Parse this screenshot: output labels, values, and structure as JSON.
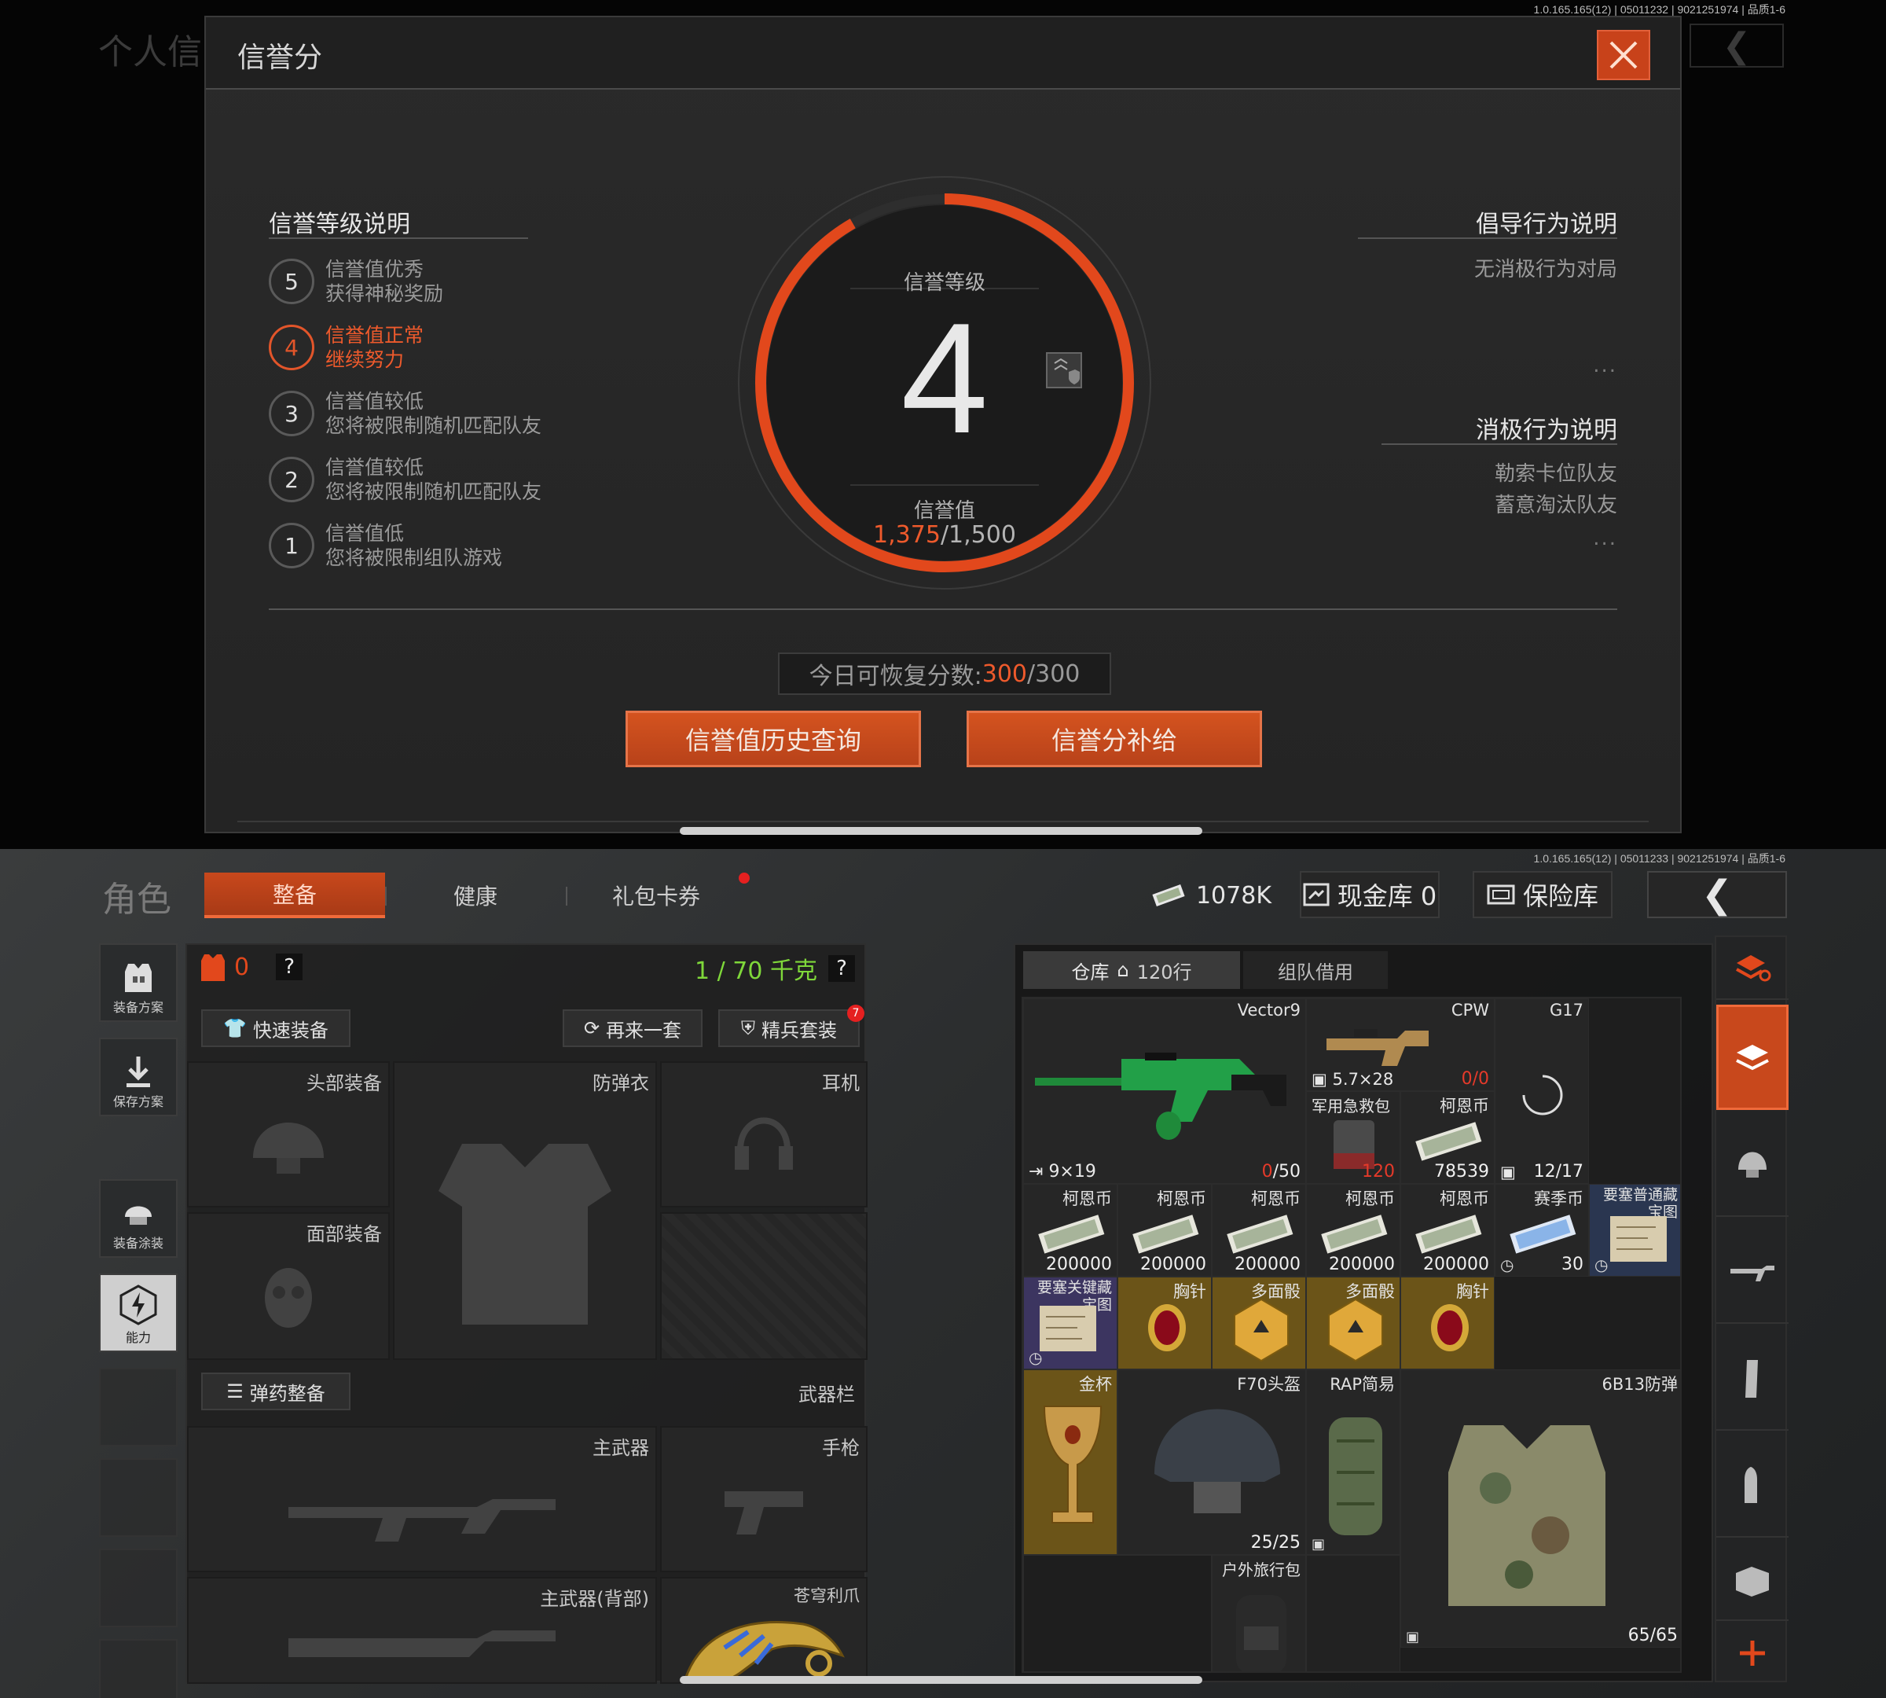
{
  "top": {
    "version": "1.0.165.165(12) | 05011232 | 9021251974 | 品质1-6",
    "bg_title": "个人信",
    "dialog": {
      "title": "信誉分",
      "level_section_title": "信誉等级说明",
      "levels": [
        {
          "num": "5",
          "line1": "信誉值优秀",
          "line2": "获得神秘奖励",
          "active": false
        },
        {
          "num": "4",
          "line1": "信誉值正常",
          "line2": "继续努力",
          "active": true
        },
        {
          "num": "3",
          "line1": "信誉值较低",
          "line2": "您将被限制随机匹配队友",
          "active": false
        },
        {
          "num": "2",
          "line1": "信誉值较低",
          "line2": "您将被限制随机匹配队友",
          "active": false
        },
        {
          "num": "1",
          "line1": "信誉值低",
          "line2": "您将被限制组队游戏",
          "active": false
        }
      ],
      "gauge": {
        "level_label": "信誉等级",
        "level_value": "4",
        "score_label": "信誉值",
        "score_current": "1,375",
        "score_max": "/1,500",
        "fraction": 0.9167
      },
      "guide_title": "倡导行为说明",
      "guide_items": [
        "无消极行为对局"
      ],
      "negative_title": "消极行为说明",
      "negative_items": [
        "勒索卡位队友",
        "蓄意淘汰队友"
      ],
      "dots": "...",
      "recover_label": "今日可恢复分数:",
      "recover_current": "300",
      "recover_max": "/300",
      "btn_history": "信誉值历史查询",
      "btn_replenish": "信誉分补给"
    }
  },
  "bottom": {
    "version": "1.0.165.165(12) | 05011233 | 9021251974 | 品质1-6",
    "title": "角色",
    "tabs": [
      "整备",
      "健康",
      "礼包卡券"
    ],
    "money": "1078K",
    "cash_vault": "现金库 0",
    "safe_vault": "保险库",
    "side_buttons": [
      "装备方案",
      "保存方案",
      "装备涂装",
      "能力"
    ],
    "loadout": {
      "armor_count": "0",
      "weight": "1 / 70 千克",
      "help": "?",
      "quick_equip": "快速装备",
      "again": "再来一套",
      "elite": "精兵套装",
      "elite_badge": "7",
      "slots": {
        "head": "头部装备",
        "vest": "防弹衣",
        "ear": "耳机",
        "face": "面部装备",
        "ammo": "弹药整备",
        "weapon_bar": "武器栏",
        "primary": "主武器",
        "pistol": "手枪",
        "primary_back": "主武器(背部)",
        "melee": "苍穹利爪"
      }
    },
    "storage": {
      "tab_vault": "仓库",
      "vault_rows": "120行",
      "tab_team": "组队借用",
      "items": [
        {
          "name": "Vector9",
          "ammo": "9×19",
          "count": "0",
          "max": "/50"
        },
        {
          "name": "CPW",
          "ammo": "5.7×28",
          "count": "0/0"
        },
        {
          "name": "G17",
          "count": "12/17"
        },
        {
          "name": "军用急救包",
          "count": "120"
        },
        {
          "name": "柯恩币",
          "count": "78539"
        },
        {
          "name": "柯恩币",
          "count": "200000"
        },
        {
          "name": "柯恩币",
          "count": "200000"
        },
        {
          "name": "柯恩币",
          "count": "200000"
        },
        {
          "name": "柯恩币",
          "count": "200000"
        },
        {
          "name": "柯恩币",
          "count": "200000"
        },
        {
          "name": "赛季币",
          "count": "30"
        },
        {
          "name": "要塞普通藏宝图"
        },
        {
          "name": "要塞关键藏宝图"
        },
        {
          "name": "胸针"
        },
        {
          "name": "多面骰"
        },
        {
          "name": "多面骰"
        },
        {
          "name": "胸针"
        },
        {
          "name": "金杯"
        },
        {
          "name": "F70头盔",
          "count": "25/25"
        },
        {
          "name": "RAP简易"
        },
        {
          "name": "6B13防弹",
          "count": "65/65"
        },
        {
          "name": "户外旅行包"
        }
      ]
    },
    "colors": {
      "accent": "#c8481c",
      "highlight": "#ee5a2c",
      "weight_green": "#7fd83a"
    }
  }
}
